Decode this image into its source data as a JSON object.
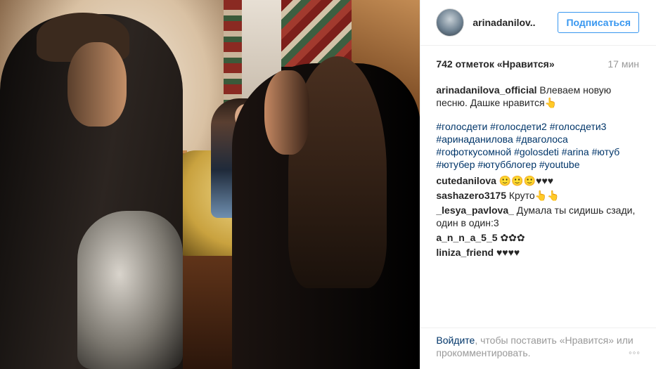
{
  "post": {
    "username": "arinadanilov..",
    "follow_label": "Подписаться",
    "likes": "742 отметок «Нравится»",
    "time": "17 мин",
    "caption": {
      "user": "arinadanilova_official",
      "text": " Влеваем новую песню. Дашке нравится👆"
    },
    "hashtags": [
      "#голосдети",
      "#голосдети2",
      "#голосдети3",
      "#аринаданилова",
      "#дваголоса",
      "#гофоткусомной",
      "#golosdeti",
      "#arina",
      "#ютуб",
      "#ютубер",
      "#ютубблогер",
      "#youtube"
    ],
    "comments": [
      {
        "user": "cutedanilova",
        "text": "🙂🙂🙂♥♥♥"
      },
      {
        "user": "sashazero3175",
        "text": "Круто👆👆"
      },
      {
        "user": "_lesya_pavlova_",
        "text": "Думала ты сидишь сзади, один в один:3"
      },
      {
        "user": "a_n_n_a_5_5",
        "text": "✿✿✿"
      },
      {
        "user": "liniza_friend",
        "text": "♥♥♥♥"
      }
    ],
    "footer": {
      "login_link": "Войдите",
      "prompt": ", чтобы поставить «Нравится» или прокомментировать."
    },
    "more_icon": "ellipsis-icon"
  }
}
